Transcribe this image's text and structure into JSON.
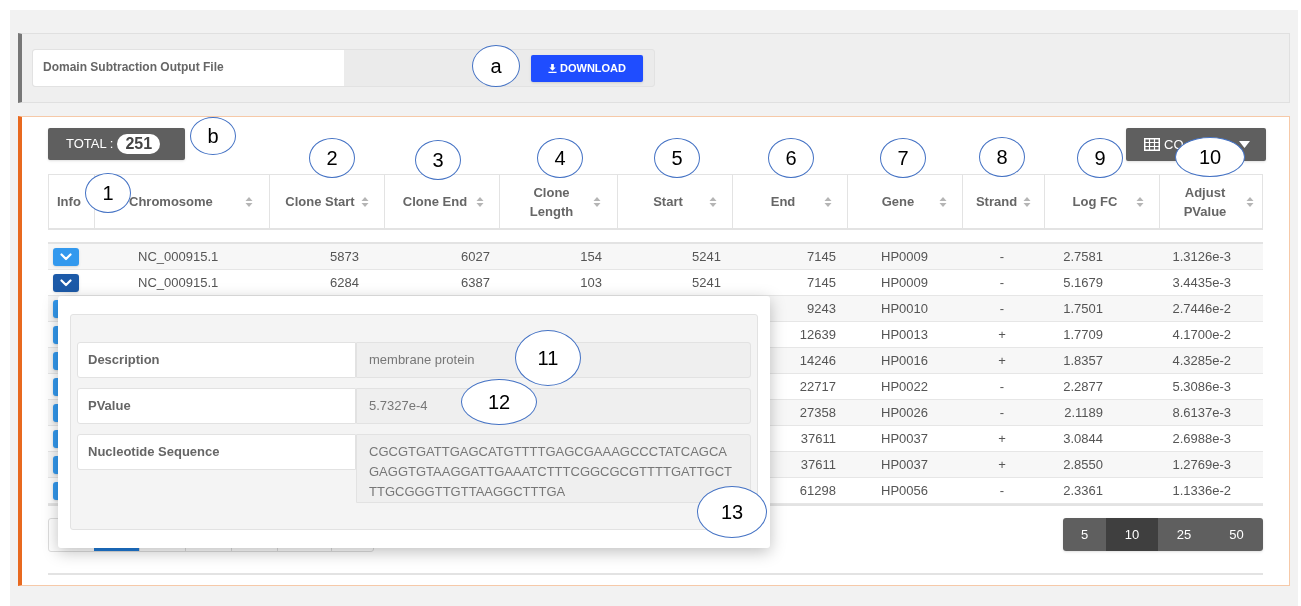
{
  "file_panel": {
    "label": "Domain Subtraction Output File",
    "download_button": "DOWNLOAD"
  },
  "total": {
    "label": "TOTAL :",
    "count": "251"
  },
  "columns_button": {
    "label": "CO"
  },
  "table": {
    "columns": [
      "Info",
      "Chromosome",
      "Clone Start",
      "Clone End",
      "Clone Length",
      "Start",
      "End",
      "Gene",
      "Strand",
      "Log FC",
      "Adjust PValue"
    ],
    "rows": [
      {
        "expanded": false,
        "cells": [
          "",
          "NC_000915.1",
          "5873",
          "6027",
          "154",
          "5241",
          "7145",
          "HP0009",
          "-",
          "2.7581",
          "1.3126e-3"
        ]
      },
      {
        "expanded": true,
        "cells": [
          "",
          "NC_000915.1",
          "6284",
          "6387",
          "103",
          "5241",
          "7145",
          "HP0009",
          "-",
          "5.1679",
          "3.4435e-3"
        ]
      },
      {
        "expanded": false,
        "cells": [
          "",
          "",
          "",
          "",
          "",
          "",
          "9243",
          "HP0010",
          "-",
          "1.7501",
          "2.7446e-2"
        ]
      },
      {
        "expanded": false,
        "cells": [
          "",
          "",
          "",
          "",
          "",
          "",
          "12639",
          "HP0013",
          "+",
          "1.7709",
          "4.1700e-2"
        ]
      },
      {
        "expanded": false,
        "cells": [
          "",
          "",
          "",
          "",
          "",
          "",
          "14246",
          "HP0016",
          "+",
          "1.8357",
          "4.3285e-2"
        ]
      },
      {
        "expanded": false,
        "cells": [
          "",
          "",
          "",
          "",
          "",
          "",
          "22717",
          "HP0022",
          "-",
          "2.2877",
          "5.3086e-3"
        ]
      },
      {
        "expanded": false,
        "cells": [
          "",
          "",
          "",
          "",
          "",
          "",
          "27358",
          "HP0026",
          "-",
          "2.1189",
          "8.6137e-3"
        ]
      },
      {
        "expanded": false,
        "cells": [
          "",
          "",
          "",
          "",
          "",
          "",
          "37611",
          "HP0037",
          "+",
          "3.0844",
          "2.6988e-3"
        ]
      },
      {
        "expanded": false,
        "cells": [
          "",
          "",
          "",
          "",
          "",
          "",
          "37611",
          "HP0037",
          "+",
          "2.8550",
          "1.2769e-3"
        ]
      },
      {
        "expanded": false,
        "cells": [
          "",
          "",
          "",
          "",
          "",
          "",
          "61298",
          "HP0056",
          "-",
          "2.3361",
          "1.1336e-2"
        ]
      }
    ]
  },
  "detail_popup": {
    "fields": [
      {
        "label": "Description",
        "value": "membrane protein"
      },
      {
        "label": "PValue",
        "value": "5.7327e-4"
      },
      {
        "label": "Nucleotide Sequence",
        "value": "CGCGTGATTGAGCATGTTTTGAGCGAAAGCCCTATCAGCAGAGGTGTAAGGATTGAAATCTTTCGGCGCGTTTTGATTGCTTTGCGGGTTGTTAAGGCTTTGA"
      }
    ]
  },
  "page_sizes": [
    {
      "label": "5",
      "selected": false
    },
    {
      "label": "10",
      "selected": true
    },
    {
      "label": "25",
      "selected": false
    },
    {
      "label": "50",
      "selected": false
    }
  ],
  "callouts": [
    "a",
    "b",
    "1",
    "2",
    "3",
    "4",
    "5",
    "6",
    "7",
    "8",
    "9",
    "10",
    "11",
    "12",
    "13"
  ]
}
